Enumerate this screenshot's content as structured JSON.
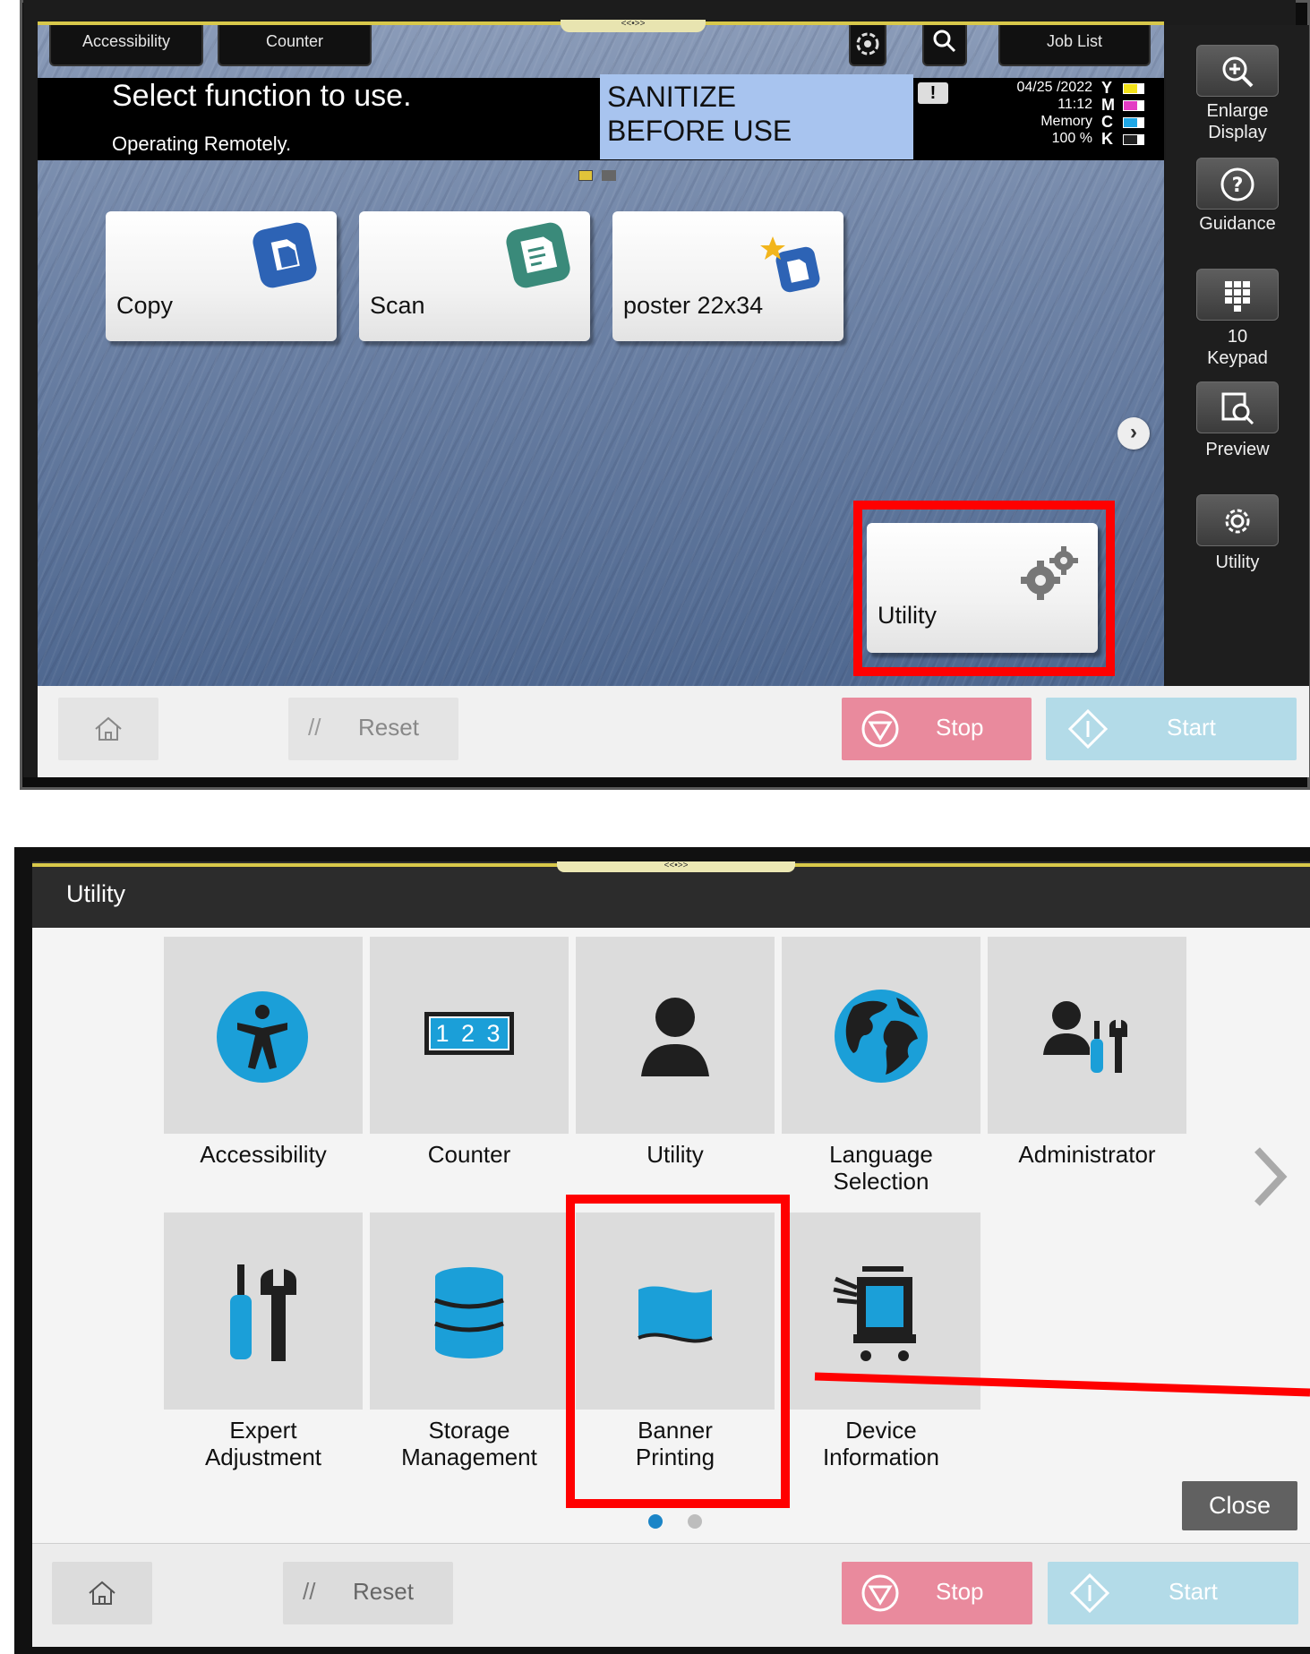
{
  "screen1": {
    "top_buttons": {
      "accessibility": "Accessibility",
      "counter": "Counter",
      "job_list": "Job List"
    },
    "handle": "<<•>>",
    "title": "Select function to use.",
    "subtitle": "Operating Remotely.",
    "sanitize": {
      "line1": "SANITIZE",
      "line2": "BEFORE USE"
    },
    "status": {
      "date": "04/25 /2022",
      "time": "11:12",
      "memory_label": "Memory",
      "memory_value": "100 %"
    },
    "toners": [
      {
        "letter": "Y",
        "color": "#f2e21a",
        "level": 0.7
      },
      {
        "letter": "M",
        "color": "#e33cc4",
        "level": 0.7
      },
      {
        "letter": "C",
        "color": "#1fa7e6",
        "level": 0.7
      },
      {
        "letter": "K",
        "color": "#222222",
        "level": 0.7
      }
    ],
    "tiles": {
      "copy": "Copy",
      "scan": "Scan",
      "poster": "poster  22x34",
      "utility": "Utility"
    },
    "sidebar": {
      "enlarge_line1": "Enlarge",
      "enlarge_line2": "Display",
      "guidance": "Guidance",
      "keypad_line1": "10",
      "keypad_line2": "Keypad",
      "preview": "Preview",
      "utility": "Utility"
    },
    "bottom": {
      "reset": "Reset",
      "stop": "Stop",
      "start": "Start"
    }
  },
  "screen2": {
    "header": "Utility",
    "handle": "<<•>>",
    "items_row1": [
      {
        "label": "Accessibility"
      },
      {
        "label": "Counter",
        "display": "1 2 3"
      },
      {
        "label": "Utility"
      },
      {
        "label_line1": "Language",
        "label_line2": "Selection"
      },
      {
        "label": "Administrator"
      }
    ],
    "items_row2": [
      {
        "label_line1": "Expert",
        "label_line2": "Adjustment"
      },
      {
        "label_line1": "Storage",
        "label_line2": "Management"
      },
      {
        "label_line1": "Banner",
        "label_line2": "Printing"
      },
      {
        "label_line1": "Device",
        "label_line2": "Information"
      }
    ],
    "close": "Close",
    "bottom": {
      "reset": "Reset",
      "stop": "Stop",
      "start": "Start"
    },
    "colors": {
      "accent": "#1b9fd8",
      "icon_dark": "#1f1f1f",
      "highlight": "#ff0000"
    }
  }
}
